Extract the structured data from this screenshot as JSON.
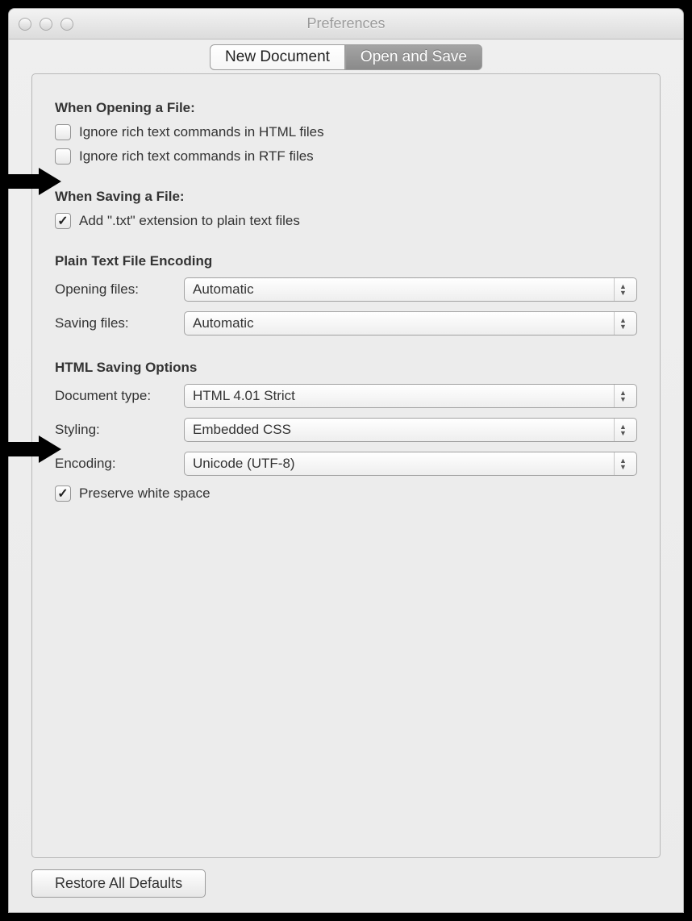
{
  "window": {
    "title": "Preferences"
  },
  "tabs": {
    "inactive": "New Document",
    "active": "Open and Save"
  },
  "opening": {
    "heading": "When Opening a File:",
    "opt1": "Ignore rich text commands in HTML files",
    "opt2": "Ignore rich text commands in RTF files"
  },
  "saving": {
    "heading": "When Saving a File:",
    "opt1": "Add \".txt\" extension to plain text files"
  },
  "encoding": {
    "heading": "Plain Text File Encoding",
    "opening_label": "Opening files:",
    "opening_value": "Automatic",
    "saving_label": "Saving files:",
    "saving_value": "Automatic"
  },
  "html": {
    "heading": "HTML Saving Options",
    "doctype_label": "Document type:",
    "doctype_value": "HTML 4.01 Strict",
    "styling_label": "Styling:",
    "styling_value": "Embedded CSS",
    "encoding_label": "Encoding:",
    "encoding_value": "Unicode (UTF-8)",
    "preserve": "Preserve white space"
  },
  "footer": {
    "restore": "Restore All Defaults"
  }
}
